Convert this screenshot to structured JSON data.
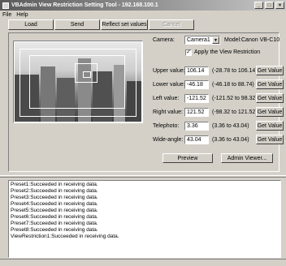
{
  "window": {
    "title": "VBAdmin View Restriction Setting Tool - 192.168.100.1"
  },
  "menu": {
    "file": "File",
    "help": "Help"
  },
  "toolbar": {
    "load": "Load",
    "send": "Send",
    "reflect": "Reflect set values",
    "cancel": "Cancel"
  },
  "camera": {
    "label": "Camera:",
    "selected": "Camera1",
    "model_label": "Model:",
    "model": "Canon VB-C10"
  },
  "apply": {
    "label": "Apply the View Restriction",
    "checked": true,
    "mark": "✓"
  },
  "fields": [
    {
      "label": "Upper value:",
      "value": "106.14",
      "range": "(-28.78 to 106.14)",
      "button": "Get Value"
    },
    {
      "label": "Lower value:",
      "value": "-46.18",
      "range": "(-46.18 to 88.74)",
      "button": "Get Value"
    },
    {
      "label": "Left value:",
      "value": "-121.52",
      "range": "(-121.52 to 98.32)",
      "button": "Get Value"
    },
    {
      "label": "Right value:",
      "value": "121.52",
      "range": "(-98.32 to 121.52)",
      "button": "Get Value"
    },
    {
      "label": "Telephoto:",
      "value": "3.36",
      "range": "(3.36 to 43.04)",
      "button": "Get Value"
    },
    {
      "label": "Wide-angle:",
      "value": "43.04",
      "range": "(3.36 to 43.04)",
      "button": "Get Value"
    }
  ],
  "actions": {
    "preview": "Preview",
    "admin_viewer": "Admin Viewer..."
  },
  "log": [
    "Preset1:Succeeded in receiving data.",
    "Preset2:Succeeded in receiving data.",
    "Preset3:Succeeded in receiving data.",
    "Preset4:Succeeded in receiving data.",
    "Preset5:Succeeded in receiving data.",
    "Preset6:Succeeded in receiving data.",
    "Preset7:Succeeded in receiving data.",
    "Preset8:Succeeded in receiving data.",
    "ViewRestriction1:Succeeded in receiving data."
  ],
  "window_controls": {
    "minimize": "_",
    "maximize": "□",
    "close": "×"
  }
}
